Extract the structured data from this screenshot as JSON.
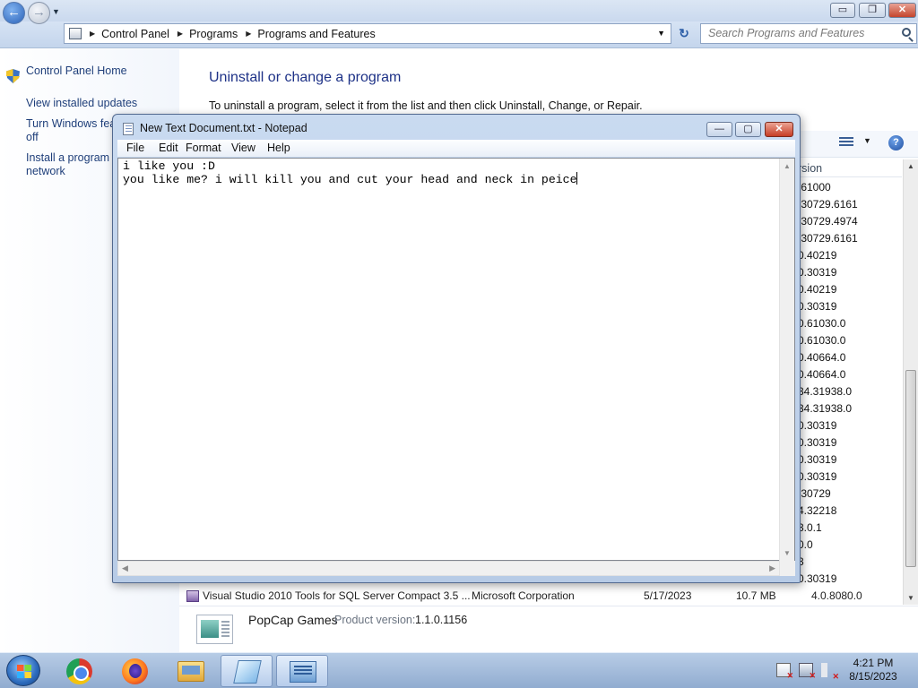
{
  "explorer": {
    "window_buttons": {
      "minimize": "▭",
      "maximize": "❐",
      "close": "✕"
    },
    "breadcrumbs": [
      "Control Panel",
      "Programs",
      "Programs and Features"
    ],
    "search_placeholder": "Search Programs and Features",
    "left_pane": {
      "control_panel_home": "Control Panel Home",
      "view_installed_updates": "View installed updates",
      "turn_features_line1": "Turn Windows fea",
      "turn_features_line2": "off",
      "install_network_line1": "Install a program f",
      "install_network_line2": "network"
    },
    "main_title": "Uninstall or change a program",
    "main_description": "To uninstall a program, select it from the list and then click Uninstall, Change, or Repair.",
    "version_column_header": "rsion",
    "version_values": [
      ".61000",
      ".30729.6161",
      ".30729.4974",
      ".30729.6161",
      "0.40219",
      "0.30319",
      "0.40219",
      "0.30319",
      "0.61030.0",
      "0.61030.0",
      "0.40664.0",
      "0.40664.0",
      "34.31938.0",
      "34.31938.0",
      "0.30319",
      "0.30319",
      "0.30319",
      "0.30319",
      ".30729",
      "4.32218",
      "3.0.1",
      "0.0",
      "3",
      "0.30319"
    ],
    "visible_row": {
      "name": "Visual Studio 2010 Tools for SQL Server Compact 3.5 ...",
      "publisher": "Microsoft Corporation",
      "installed_on": "5/17/2023",
      "size": "10.7 MB",
      "version": "4.0.8080.0"
    },
    "details": {
      "name": "PopCap Games",
      "version_label": "Product version:",
      "version_value": "1.1.0.1156"
    }
  },
  "notepad": {
    "title": "New Text Document.txt - Notepad",
    "menu": [
      "File",
      "Edit",
      "Format",
      "View",
      "Help"
    ],
    "lines": [
      "i like you :D",
      "you like me? i will kill you and cut your head and neck in peice"
    ]
  },
  "taskbar": {
    "clock_time": "4:21 PM",
    "clock_date": "8/15/2023"
  }
}
